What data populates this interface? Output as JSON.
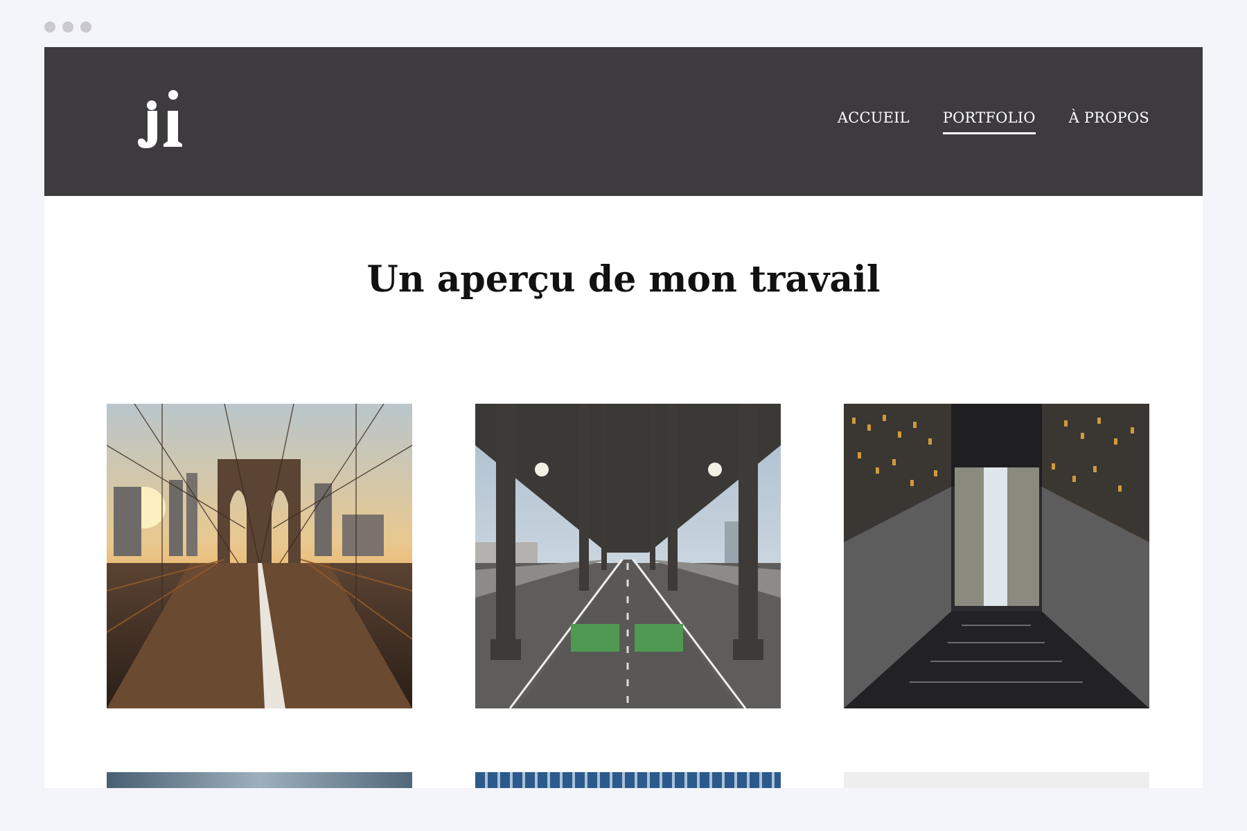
{
  "browser": {
    "dots": [
      "dot",
      "dot",
      "dot"
    ]
  },
  "header": {
    "logo_text": "JI",
    "nav": [
      {
        "label": "ACCUEIL",
        "active": false
      },
      {
        "label": "PORTFOLIO",
        "active": true
      },
      {
        "label": "À PROPOS",
        "active": false
      }
    ]
  },
  "main": {
    "heading": "Un aperçu de mon travail"
  },
  "colors": {
    "header_bg": "#3d3b3e",
    "page_bg": "#f4f4fb",
    "text": "#111111"
  }
}
